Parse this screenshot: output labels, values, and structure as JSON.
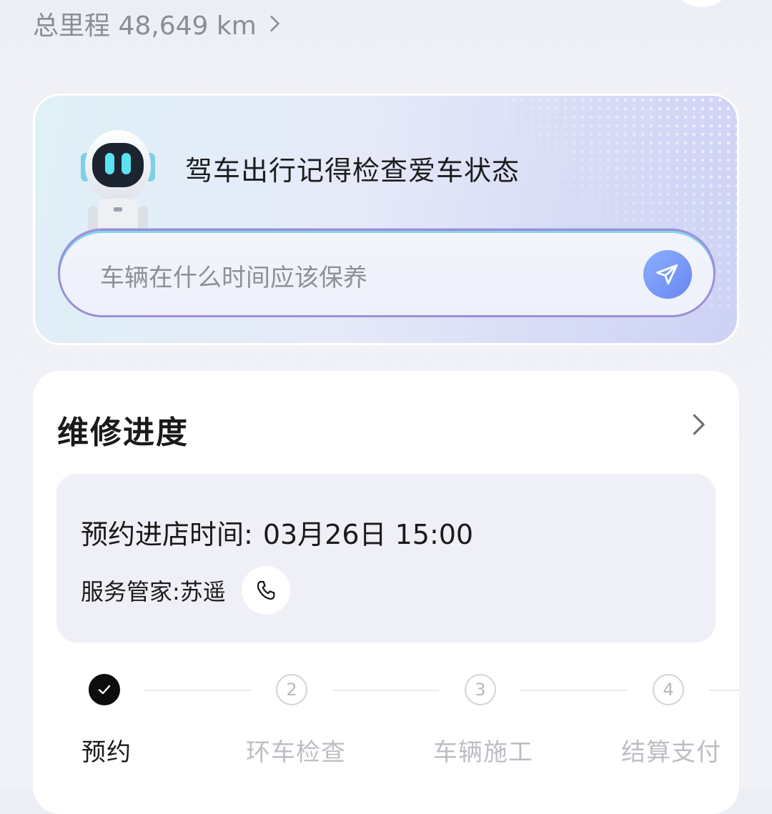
{
  "header": {
    "mileage_text": "总里程 48,649 km"
  },
  "ai_card": {
    "title": "驾车出行记得检查爱车状态",
    "input_placeholder": "车辆在什么时间应该保养"
  },
  "repair": {
    "title": "维修进度",
    "appointment_label": "预约进店时间:",
    "appointment_value": "03月26日 15:00",
    "butler_text": "服务管家:苏遥",
    "steps": [
      {
        "number": "",
        "label": "预约",
        "status": "done"
      },
      {
        "number": "2",
        "label": "环车检查",
        "status": "pending"
      },
      {
        "number": "3",
        "label": "车辆施工",
        "status": "pending"
      },
      {
        "number": "4",
        "label": "结算支付",
        "status": "pending"
      }
    ]
  },
  "colors": {
    "accent": "#6a86f0",
    "done_step": "#0d0d0d",
    "pending_text": "#bdbec4"
  }
}
